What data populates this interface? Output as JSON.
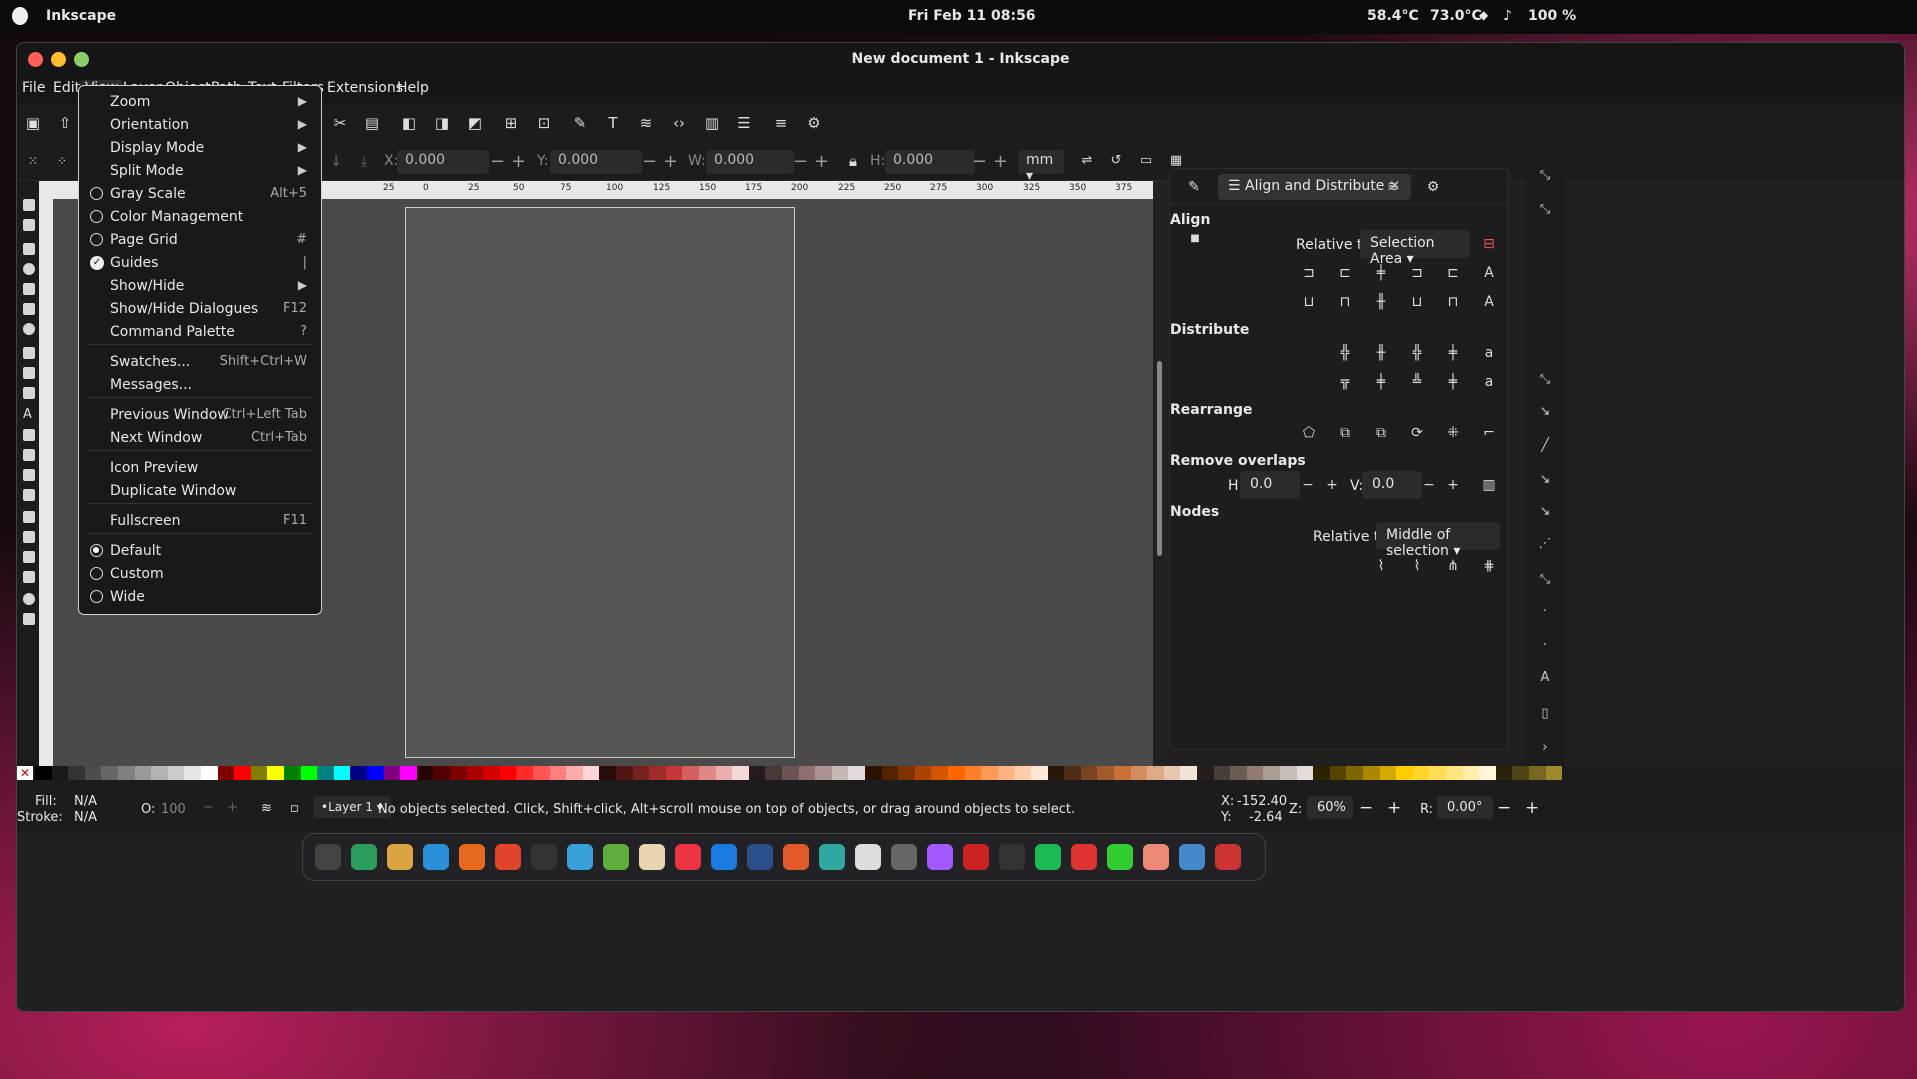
{
  "system_bar": {
    "app_name": "Inkscape",
    "clock": "Fri Feb 11  08:56",
    "temp1": "58.4°C",
    "temp2": "73.0°C",
    "battery": "100 %"
  },
  "window": {
    "title": "New document 1 - Inkscape"
  },
  "menubar": [
    "File",
    "Edit",
    "View",
    "Layer",
    "Object",
    "Path",
    "Text",
    "Filters",
    "Extensions",
    "Help"
  ],
  "toolbar2": {
    "x_label": "X:",
    "x_value": "0.000",
    "y_label": "Y:",
    "y_value": "0.000",
    "w_label": "W:",
    "w_value": "0.000",
    "h_label": "H:",
    "h_value": "0.000",
    "unit": "mm"
  },
  "ruler_ticks": [
    "25",
    "0",
    "25",
    "50",
    "75",
    "100",
    "125",
    "150",
    "175",
    "200",
    "225",
    "250",
    "275",
    "300",
    "325",
    "350",
    "375"
  ],
  "view_menu": {
    "items": [
      {
        "label": "Zoom",
        "kind": "submenu"
      },
      {
        "label": "Orientation",
        "kind": "submenu"
      },
      {
        "label": "Display Mode",
        "kind": "submenu"
      },
      {
        "label": "Split Mode",
        "kind": "submenu"
      },
      {
        "label": "Gray Scale",
        "kind": "radio",
        "checked": false,
        "shortcut": "Alt+5"
      },
      {
        "label": "Color Management",
        "kind": "radio",
        "checked": false,
        "shortcut": ""
      },
      {
        "label": "Page Grid",
        "kind": "radio",
        "checked": false,
        "shortcut": "#"
      },
      {
        "label": "Guides",
        "kind": "check",
        "checked": true,
        "shortcut": "|"
      },
      {
        "label": "Show/Hide",
        "kind": "submenu"
      },
      {
        "label": "Show/Hide Dialogues",
        "kind": "plain",
        "shortcut": "F12"
      },
      {
        "label": "Command Palette",
        "kind": "plain",
        "shortcut": "?"
      },
      {
        "label": "Swatches...",
        "kind": "plain",
        "shortcut": "Shift+Ctrl+W"
      },
      {
        "label": "Messages...",
        "kind": "plain",
        "shortcut": ""
      },
      {
        "label": "Previous Window",
        "kind": "plain",
        "shortcut": "Ctrl+Left Tab"
      },
      {
        "label": "Next Window",
        "kind": "plain",
        "shortcut": "Ctrl+Tab"
      },
      {
        "label": "Icon Preview",
        "kind": "plain",
        "shortcut": ""
      },
      {
        "label": "Duplicate Window",
        "kind": "plain",
        "shortcut": ""
      },
      {
        "label": "Fullscreen",
        "kind": "plain",
        "shortcut": "F11"
      },
      {
        "label": "Default",
        "kind": "radio",
        "checked": true,
        "shortcut": ""
      },
      {
        "label": "Custom",
        "kind": "radio",
        "checked": false,
        "shortcut": ""
      },
      {
        "label": "Wide",
        "kind": "radio",
        "checked": false,
        "shortcut": ""
      }
    ]
  },
  "panel": {
    "tab_title": "Align and Distribute",
    "align_heading": "Align",
    "relative_to_label": "Relative to:",
    "relative_to_value": "Selection Area",
    "distribute_heading": "Distribute",
    "rearrange_heading": "Rearrange",
    "remove_overlaps_heading": "Remove overlaps",
    "h_label": "H:",
    "h_value": "0.0",
    "v_label": "V:",
    "v_value": "0.0",
    "nodes_heading": "Nodes",
    "nodes_relative_label": "Relative to:",
    "nodes_relative_value": "Middle of selection"
  },
  "status": {
    "fill_label": "Fill:",
    "fill_value": "N/A",
    "stroke_label": "Stroke:",
    "stroke_value": "N/A",
    "opacity_label": "O:",
    "opacity_value": "100",
    "layer": "•Layer 1",
    "message": "No objects selected. Click, Shift+click, Alt+scroll mouse on top of objects, or drag around objects to select.",
    "x_label": "X:",
    "x_value": "-152.40",
    "y_label": "Y:",
    "y_value": "-2.64",
    "zoom_label": "Z:",
    "zoom_value": "60%",
    "rotate_label": "R:",
    "rotate_value": "0.00°"
  },
  "colors": {
    "accent": "#e8e8e8",
    "menu_bg": "#191919",
    "close": "#ff5f57",
    "minimize": "#febc2e",
    "maximize": "#8ccf6a"
  }
}
